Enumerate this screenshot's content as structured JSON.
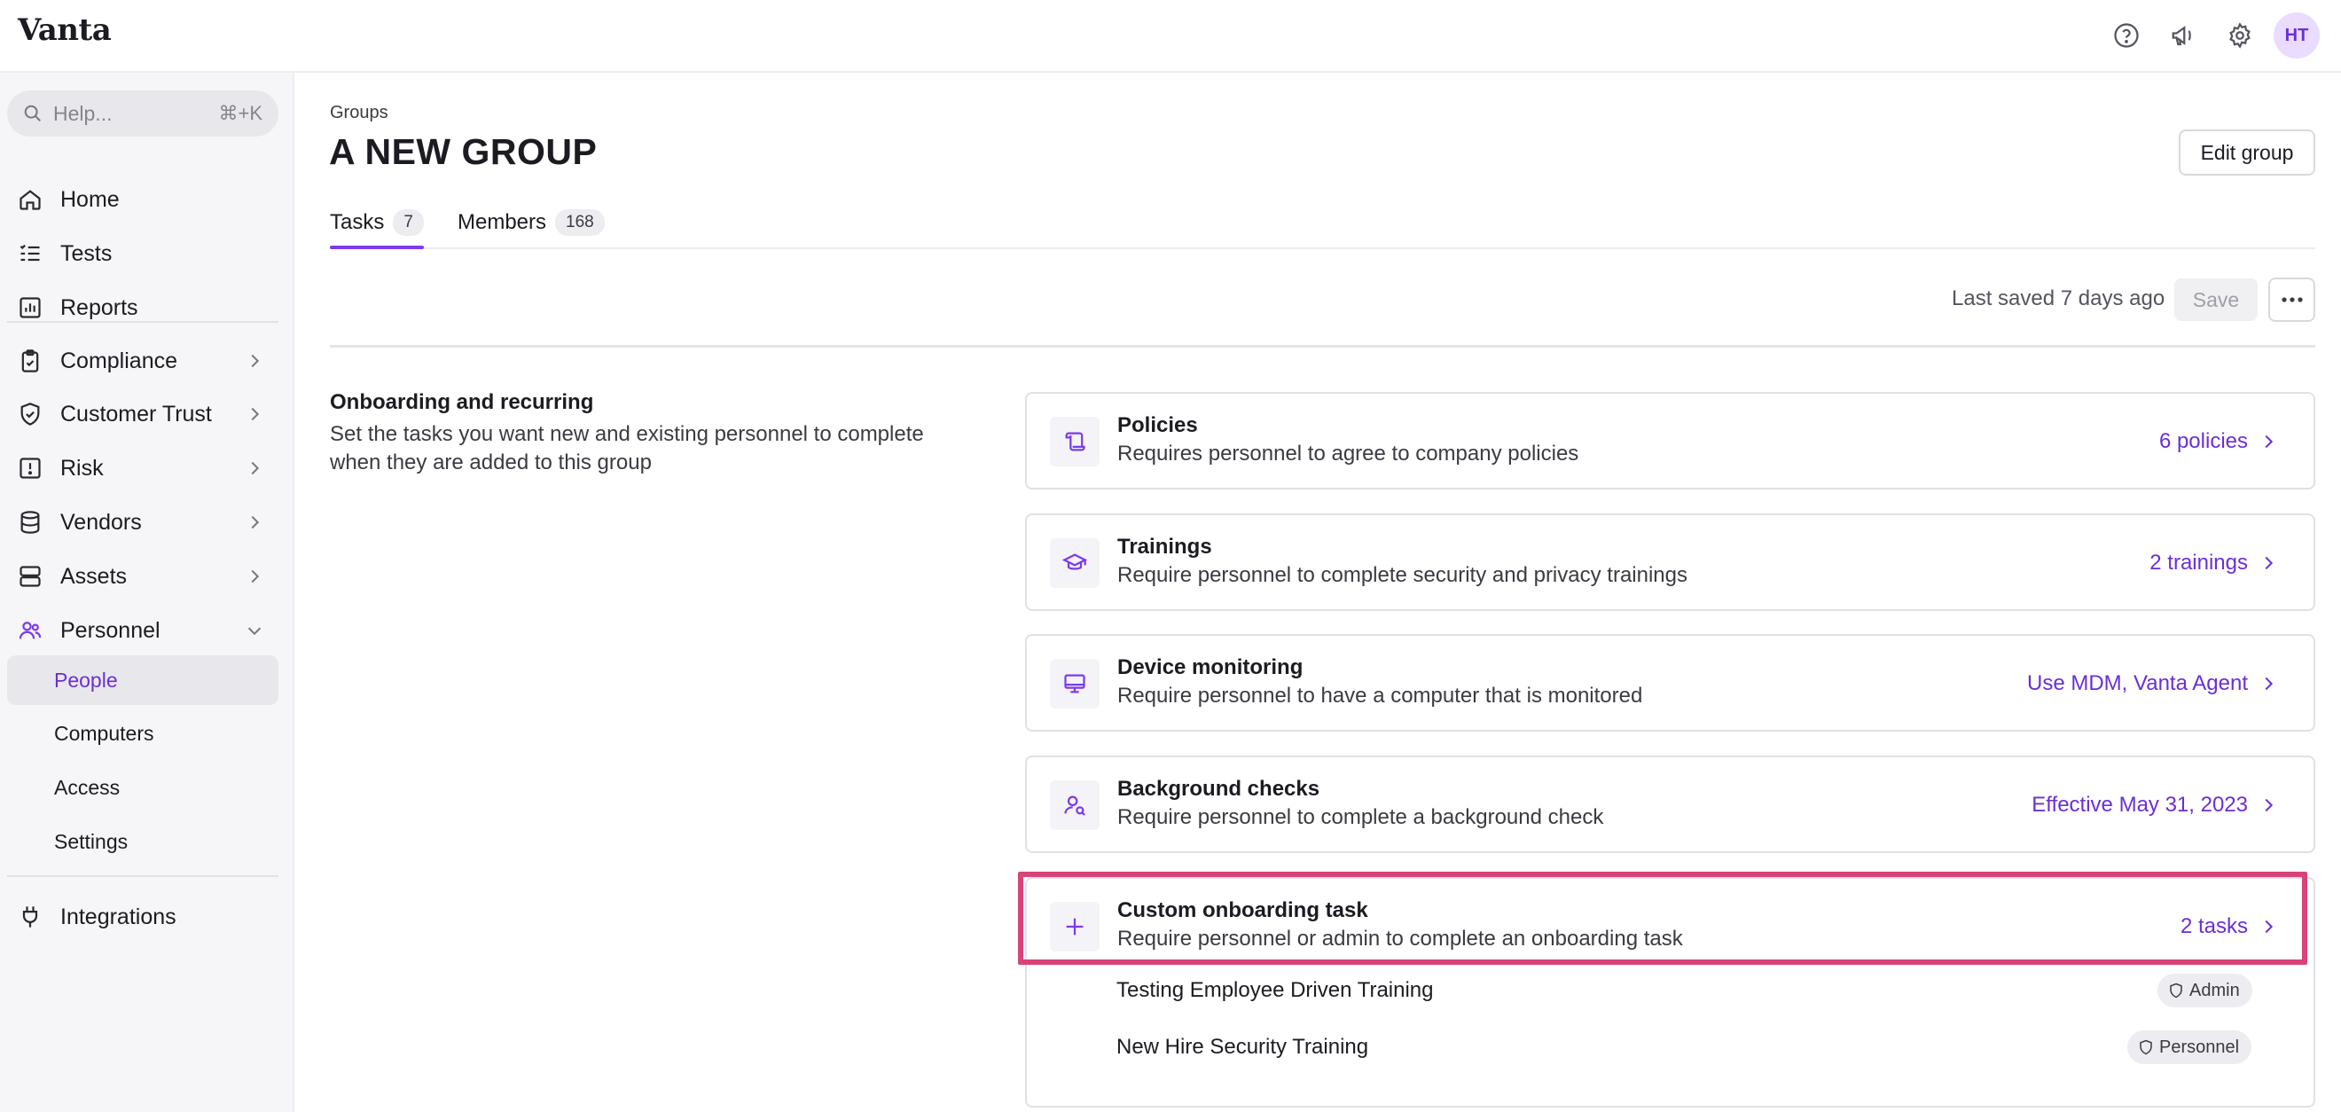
{
  "app": {
    "logo": "Vanta",
    "avatar_initials": "HT",
    "accent": "#7c3aed",
    "highlight_color": "#d8437a",
    "top_icons": [
      "help-circle-icon",
      "megaphone-icon",
      "gear-icon"
    ]
  },
  "sidebar": {
    "search_placeholder": "Help...",
    "search_shortcut": "⌘+K",
    "items": [
      {
        "label": "Home",
        "icon": "home-icon"
      },
      {
        "label": "Tests",
        "icon": "checklist-icon"
      },
      {
        "label": "Reports",
        "icon": "report-icon"
      },
      {
        "label": "Compliance",
        "icon": "clipboard-check-icon"
      },
      {
        "label": "Customer Trust",
        "icon": "shield-check-icon"
      },
      {
        "label": "Risk",
        "icon": "alert-square-icon"
      },
      {
        "label": "Vendors",
        "icon": "database-icon"
      },
      {
        "label": "Assets",
        "icon": "server-icon"
      },
      {
        "label": "Personnel",
        "icon": "people-icon"
      },
      {
        "label": "Integrations",
        "icon": "plug-icon"
      }
    ],
    "personnel_sub": [
      "People",
      "Computers",
      "Access",
      "Settings"
    ],
    "active_sub": "People"
  },
  "page": {
    "breadcrumb": "Groups",
    "title": "A NEW GROUP",
    "edit_button": "Edit group",
    "tabs": [
      {
        "label": "Tasks",
        "count": "7"
      },
      {
        "label": "Members",
        "count": "168"
      }
    ],
    "active_tab": "Tasks",
    "last_saved": "Last saved 7 days ago",
    "save_button": "Save"
  },
  "section": {
    "title": "Onboarding and recurring",
    "description": "Set the tasks you want new and existing personnel to complete when they are added to this group"
  },
  "cards": [
    {
      "title": "Policies",
      "desc": "Requires personnel to agree to company policies",
      "value": "6 policies",
      "icon": "policy-scroll-icon"
    },
    {
      "title": "Trainings",
      "desc": "Require personnel to complete security and privacy trainings",
      "value": "2 trainings",
      "icon": "graduation-cap-icon"
    },
    {
      "title": "Device monitoring",
      "desc": "Require personnel to have a computer that is monitored",
      "value": "Use MDM, Vanta Agent",
      "icon": "monitor-icon"
    },
    {
      "title": "Background checks",
      "desc": "Require personnel to complete a background check",
      "value": "Effective May 31, 2023",
      "icon": "person-search-icon"
    },
    {
      "title": "Custom onboarding task",
      "desc": "Require personnel or admin to complete an onboarding task",
      "value": "2 tasks",
      "icon": "plus-icon"
    }
  ],
  "custom_tasks": [
    {
      "name": "Testing Employee Driven Training",
      "role": "Admin"
    },
    {
      "name": "New Hire Security Training",
      "role": "Personnel"
    }
  ]
}
